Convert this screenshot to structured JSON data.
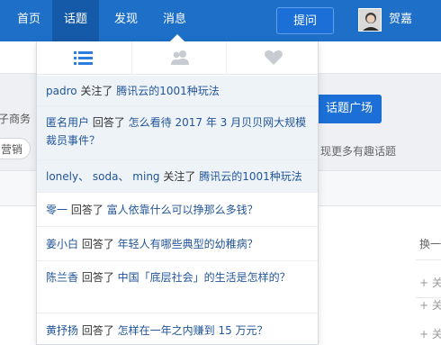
{
  "nav": {
    "items": [
      "首页",
      "话题",
      "发现",
      "消息"
    ],
    "ask_button": "提问",
    "user_name": "贺嘉"
  },
  "background": {
    "left_texts": [
      "子商务",
      "营销"
    ],
    "topic_plaza_button": "话题广场",
    "discover_text": "现更多有趣话题",
    "right_links": [
      "换一",
      "+ 关",
      "+ 关",
      "+ 关"
    ]
  },
  "dropdown": {
    "tabs": [
      {
        "icon": "list-icon"
      },
      {
        "icon": "users-icon"
      },
      {
        "icon": "heart-icon"
      }
    ],
    "items": [
      {
        "actor": "padro",
        "verb": " 关注了 ",
        "target": "腾讯云的1001种玩法",
        "unread": true
      },
      {
        "actor": "匿名用户",
        "verb": " 回答了 ",
        "target": "怎么看待 2017 年 3 月贝贝网大规模裁员事件？",
        "unread": true
      },
      {
        "actor": "lonely、 soda、 ming",
        "verb": " 关注了 ",
        "target": "腾讯云的1001种玩法",
        "unread": true
      },
      {
        "actor": "零一",
        "verb": " 回答了 ",
        "target": "富人依靠什么可以挣那么多钱？",
        "unread": false
      },
      {
        "actor": "姜小白",
        "verb": " 回答了 ",
        "target": "年轻人有哪些典型的幼稚病？",
        "unread": false
      },
      {
        "actor": "陈兰香",
        "verb": " 回答了 ",
        "target": "中国「底层社会」的生活是怎样的？",
        "unread": false
      },
      {
        "actor": "黄抒扬",
        "verb": " 回答了 ",
        "target": "怎样在一年之内赚到 15 万元？",
        "unread": false
      }
    ]
  },
  "colors": {
    "nav_bg": "#1d6fc8",
    "nav_active": "#155aa8",
    "accent": "#1b6fd6",
    "link": "#225599",
    "unread_bg": "#eef3f8"
  }
}
